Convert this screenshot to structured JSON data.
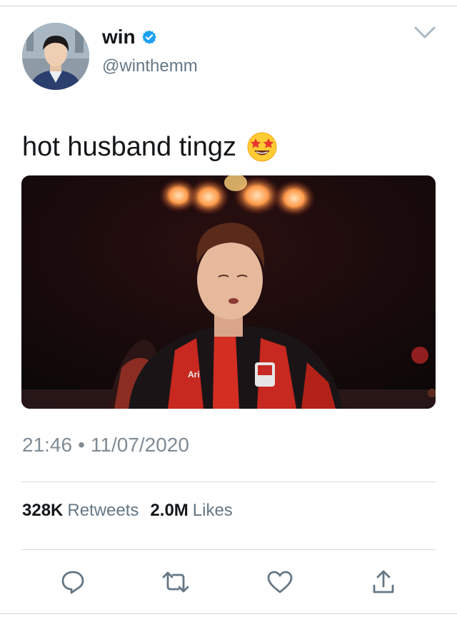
{
  "tweet": {
    "author": {
      "display_name": "win",
      "handle": "@winthemm",
      "verified": true
    },
    "text": "hot husband tingz",
    "text_emoji": "star-struck-emoji",
    "timestamp": {
      "time": "21:46",
      "separator": "•",
      "date": "11/07/2020"
    },
    "stats": {
      "retweets_count": "328K",
      "retweets_label": "Retweets",
      "likes_count": "2.0M",
      "likes_label": "Likes"
    },
    "actions": [
      "reply-icon",
      "retweet-icon",
      "like-icon",
      "share-icon"
    ]
  },
  "colors": {
    "verified_blue": "#1da1f2",
    "icon_blue": "#657786",
    "muted_text": "#657786",
    "divider": "#d7dbdf"
  }
}
